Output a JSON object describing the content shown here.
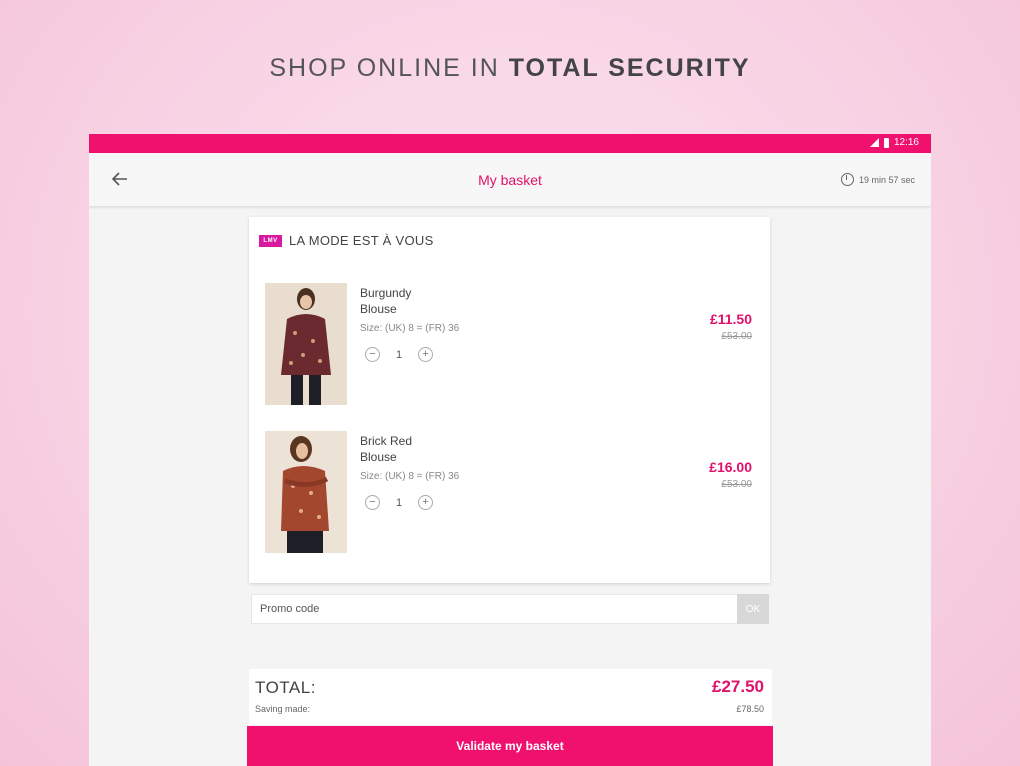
{
  "headline": {
    "light": "SHOP ONLINE IN ",
    "bold": "TOTAL SECURITY"
  },
  "status_bar": {
    "time": "12:16",
    "color": "#f0116e"
  },
  "app_bar": {
    "title": "My basket",
    "timer": "19 min 57 sec"
  },
  "brand": {
    "logo_text": "LMV",
    "name": "LA MODE EST À VOUS"
  },
  "items": [
    {
      "name": "Burgundy Blouse",
      "size": "Size: (UK) 8 = (FR) 36",
      "qty": "1",
      "price": "£11.50",
      "old_price": "£53.00",
      "qty_minus": "−",
      "qty_plus": "+"
    },
    {
      "name": "Brick Red Blouse",
      "size": "Size: (UK) 8 = (FR) 36",
      "qty": "1",
      "price": "£16.00",
      "old_price": "£53.00",
      "qty_minus": "−",
      "qty_plus": "+"
    }
  ],
  "promo": {
    "placeholder": "Promo code",
    "ok_label": "OK"
  },
  "totals": {
    "label": "TOTAL:",
    "value": "£27.50",
    "saving_label": "Saving made:",
    "saving_value": "£78.50"
  },
  "validate_label": "Validate my basket",
  "colors": {
    "accent": "#e0116c",
    "primary": "#f0116e"
  }
}
